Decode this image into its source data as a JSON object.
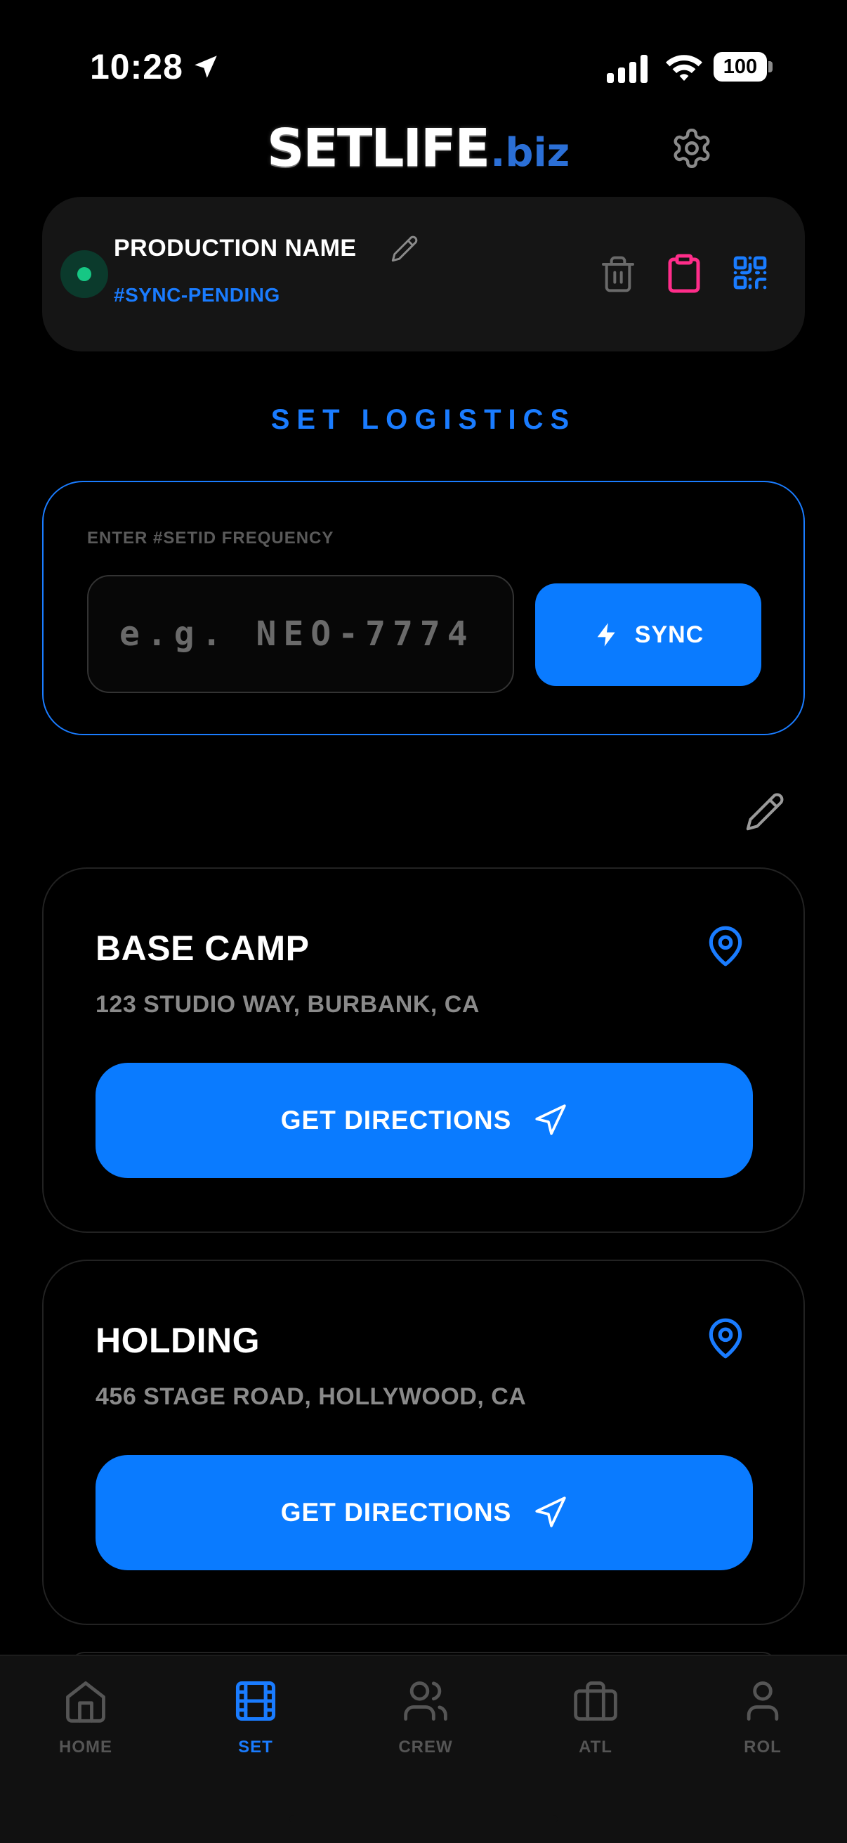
{
  "status_bar": {
    "time": "10:28",
    "battery": "100"
  },
  "header": {
    "logo_main": "SETLIFE",
    "logo_suffix": ".biz",
    "settings_icon": "gear-icon"
  },
  "production": {
    "name": "PRODUCTION NAME",
    "sync_tag": "#SYNC-PENDING",
    "status_color": "#16c784",
    "actions": [
      "trash-icon",
      "clipboard-icon",
      "qr-code-icon"
    ]
  },
  "section_title": "SET LOGISTICS",
  "frequency": {
    "label": "ENTER #SETID FREQUENCY",
    "input_value": "",
    "placeholder": "e.g. NEO-7774",
    "sync_label": "SYNC"
  },
  "locations": [
    {
      "title": "BASE CAMP",
      "address": "123 STUDIO WAY, BURBANK, CA",
      "button_label": "GET DIRECTIONS"
    },
    {
      "title": "HOLDING",
      "address": "456 STAGE ROAD, HOLLYWOOD, CA",
      "button_label": "GET DIRECTIONS"
    }
  ],
  "tabs": [
    {
      "label": "HOME",
      "icon": "home-icon",
      "active": false
    },
    {
      "label": "SET",
      "icon": "film-icon",
      "active": true
    },
    {
      "label": "CREW",
      "icon": "users-icon",
      "active": false
    },
    {
      "label": "ATL",
      "icon": "briefcase-icon",
      "active": false
    },
    {
      "label": "ROL",
      "icon": "user-icon",
      "active": false
    }
  ],
  "colors": {
    "accent": "#0a7bff",
    "pink": "#ff2d8a",
    "background": "#000000"
  }
}
